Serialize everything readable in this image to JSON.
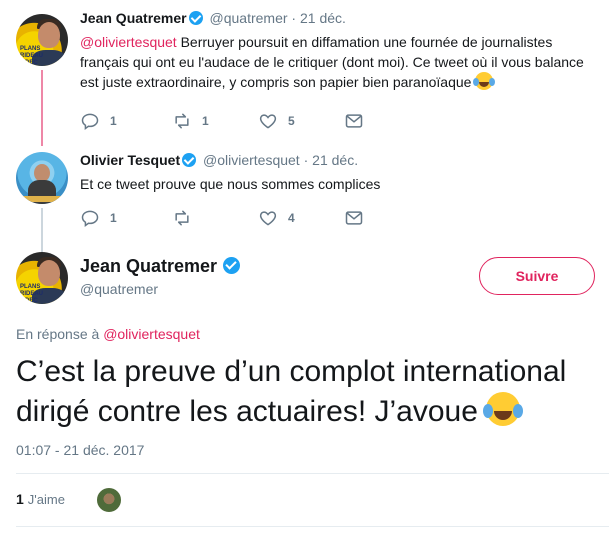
{
  "tweets": [
    {
      "author_name": "Jean Quatremer",
      "handle": "@quatremer",
      "separator": "·",
      "date": "21 déc.",
      "mention": "@oliviertesquet",
      "text": " Berruyer poursuit en diffamation une fournée de journalistes français qui ont eu l'audace de le critiquer (dont moi). Ce tweet où il vous balance est juste extraordinaire, y compris son papier bien paranoïaque ",
      "reply_count": "1",
      "retweet_count": "1",
      "like_count": "5"
    },
    {
      "author_name": "Olivier Tesquet",
      "handle": "@oliviertesquet",
      "separator": "·",
      "date": "21 déc.",
      "text": "Et ce tweet prouve que nous sommes complices",
      "reply_count": "1",
      "retweet_count": "",
      "like_count": "4"
    }
  ],
  "main_tweet": {
    "author_name": "Jean Quatremer",
    "handle": "@quatremer",
    "follow_label": "Suivre",
    "reply_prefix": "En réponse à",
    "reply_mention": "@oliviertesquet",
    "text": "C’est la preuve d’un complot international dirigé contre les actuaires! J’avoue ",
    "timestamp": "01:07 - 21 déc. 2017",
    "likes_count": "1",
    "likes_label": "J'aime"
  },
  "colors": {
    "accent": "#e0245e",
    "verified": "#1da1f2",
    "muted": "#657786"
  },
  "icons": [
    "reply-icon",
    "retweet-icon",
    "like-icon",
    "message-icon",
    "verified-icon",
    "laughing-emoji"
  ]
}
